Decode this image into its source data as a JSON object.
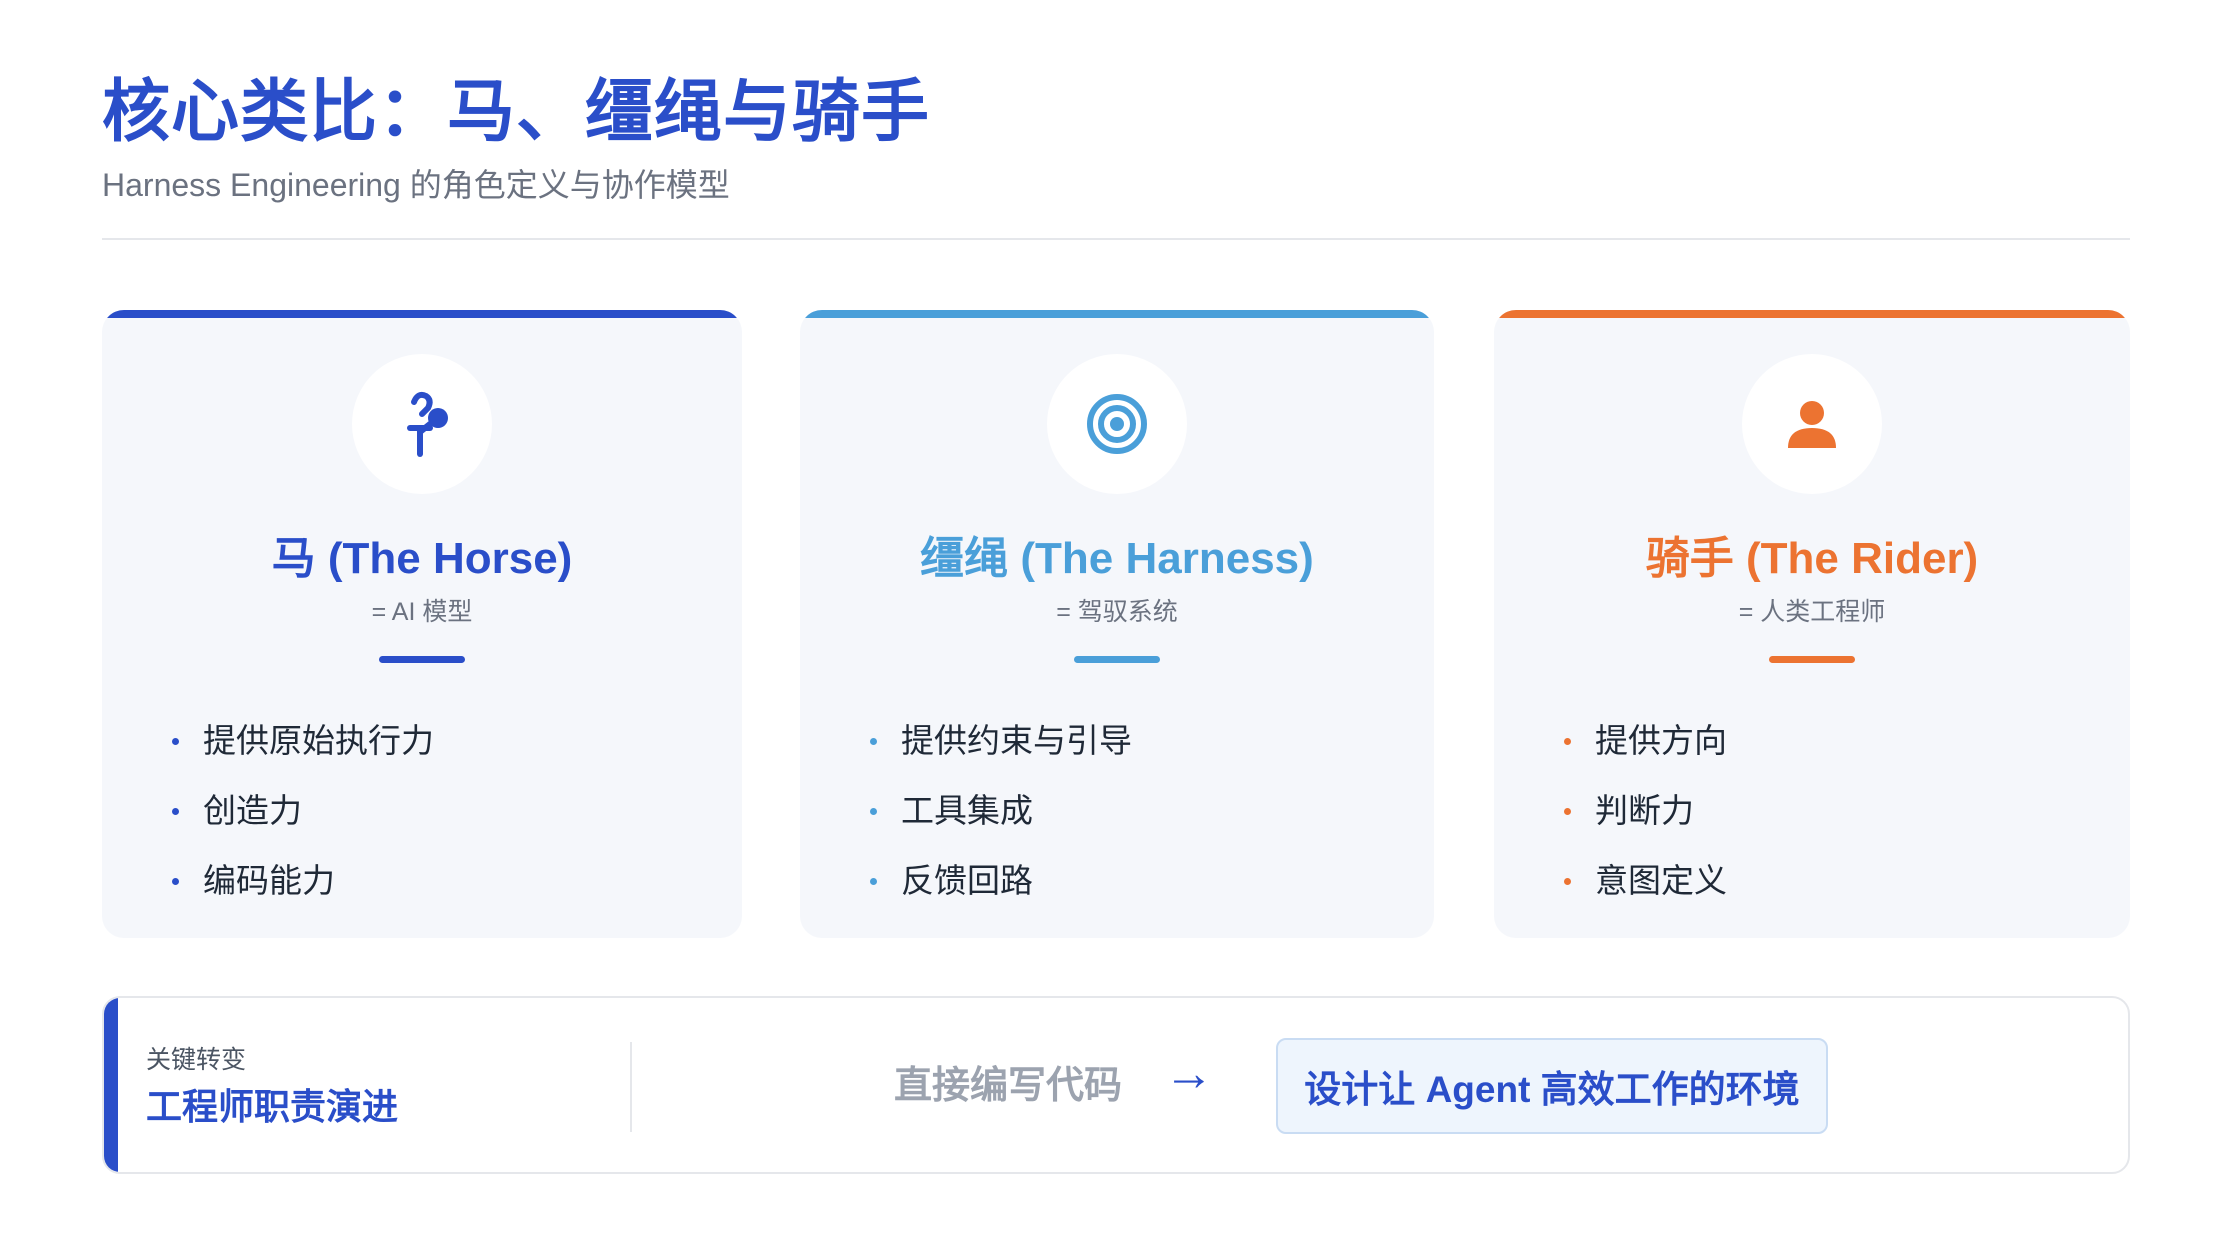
{
  "header": {
    "title": "核心类比：马、缰绳与骑手",
    "subtitle": "Harness Engineering 的角色定义与协作模型"
  },
  "cards": [
    {
      "title": "马 (The Horse)",
      "sub": "= AI 模型",
      "icon": "horse-icon",
      "color": "#2a4ec9",
      "items": [
        "提供原始执行力",
        "创造力",
        "编码能力"
      ]
    },
    {
      "title": "缰绳 (The Harness)",
      "sub": "= 驾驭系统",
      "icon": "target-icon",
      "color": "#4a9fd9",
      "items": [
        "提供约束与引导",
        "工具集成",
        "反馈回路"
      ]
    },
    {
      "title": "骑手 (The Rider)",
      "sub": "= 人类工程师",
      "icon": "person-icon",
      "color": "#ec7331",
      "items": [
        "提供方向",
        "判断力",
        "意图定义"
      ]
    }
  ],
  "bottom": {
    "kicker": "关键转变",
    "heading": "工程师职责演进",
    "old": "直接编写代码",
    "arrow": "→",
    "new": "设计让 Agent 高效工作的环境"
  }
}
